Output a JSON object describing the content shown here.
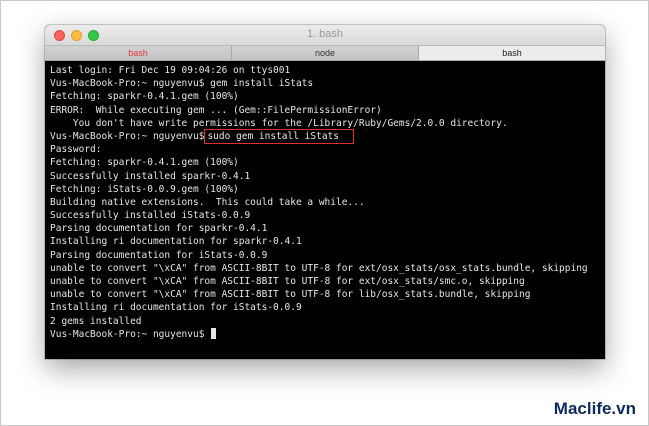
{
  "window": {
    "title": "1. bash",
    "tabs": [
      {
        "label": "bash",
        "state": "first"
      },
      {
        "label": "node",
        "state": "normal"
      },
      {
        "label": "bash",
        "state": "active"
      }
    ]
  },
  "terminal": {
    "lines": [
      {
        "text": "Last login: Fri Dec 19 09:04:26 on ttys001"
      },
      {
        "text": "Vus-MacBook-Pro:~ nguyenvu$ gem install iStats"
      },
      {
        "text": "Fetching: sparkr-0.4.1.gem (100%)"
      },
      {
        "text": "ERROR:  While executing gem ... (Gem::FilePermissionError)"
      },
      {
        "text": "    You don't have write permissions for the /Library/Ruby/Gems/2.0.0 directory."
      },
      {
        "text": "",
        "prompt": "Vus-MacBook-Pro:~ nguyenvu$",
        "command": "sudo gem install iStats"
      },
      {
        "text": "Password:"
      },
      {
        "text": "Fetching: sparkr-0.4.1.gem (100%)"
      },
      {
        "text": "Successfully installed sparkr-0.4.1"
      },
      {
        "text": "Fetching: iStats-0.0.9.gem (100%)"
      },
      {
        "text": "Building native extensions.  This could take a while..."
      },
      {
        "text": "Successfully installed iStats-0.0.9"
      },
      {
        "text": "Parsing documentation for sparkr-0.4.1"
      },
      {
        "text": "Installing ri documentation for sparkr-0.4.1"
      },
      {
        "text": "Parsing documentation for iStats-0.0.9"
      },
      {
        "text": "unable to convert \"\\xCA\" from ASCII-8BIT to UTF-8 for ext/osx_stats/osx_stats.bundle, skipping"
      },
      {
        "text": "unable to convert \"\\xCA\" from ASCII-8BIT to UTF-8 for ext/osx_stats/smc.o, skipping"
      },
      {
        "text": "unable to convert \"\\xCA\" from ASCII-8BIT to UTF-8 for lib/osx_stats.bundle, skipping"
      },
      {
        "text": "Installing ri documentation for iStats-0.0.9"
      },
      {
        "text": "2 gems installed"
      },
      {
        "text": "Vus-MacBook-Pro:~ nguyenvu$ ",
        "cursor": true
      }
    ]
  },
  "watermark": "Maclife.vn",
  "colors": {
    "terminal_bg": "#000000",
    "terminal_fg": "#e6e6e6",
    "highlight_box": "#e0312f",
    "first_tab_text": "#e03a3a",
    "watermark": "#0d2c5c"
  }
}
